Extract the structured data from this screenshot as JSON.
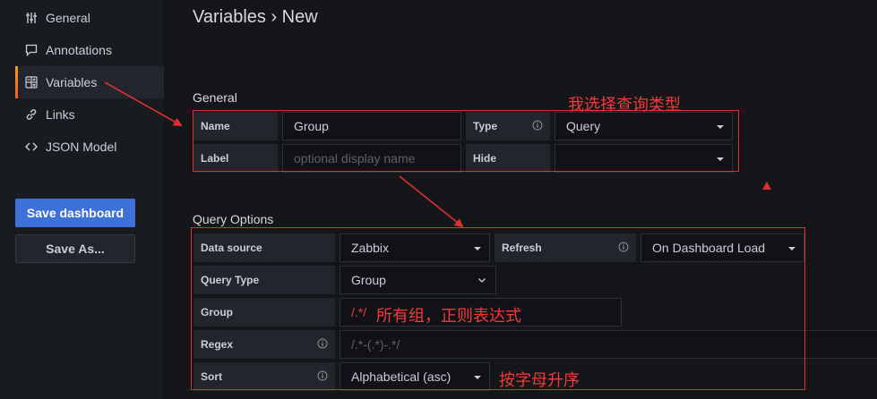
{
  "sidebar": {
    "items": [
      {
        "label": "General",
        "icon": "sliders-icon"
      },
      {
        "label": "Annotations",
        "icon": "comment-icon"
      },
      {
        "label": "Variables",
        "icon": "calculator-icon"
      },
      {
        "label": "Links",
        "icon": "link-icon"
      },
      {
        "label": "JSON Model",
        "icon": "code-icon"
      }
    ],
    "save_dashboard": "Save dashboard",
    "save_as": "Save As..."
  },
  "header": {
    "title": "Variables › New"
  },
  "general": {
    "heading": "General",
    "name_label": "Name",
    "name_value": "Group",
    "type_label": "Type",
    "type_value": "Query",
    "label_label": "Label",
    "label_placeholder": "optional display name",
    "hide_label": "Hide",
    "hide_value": ""
  },
  "query_options": {
    "heading": "Query Options",
    "datasource_label": "Data source",
    "datasource_value": "Zabbix",
    "refresh_label": "Refresh",
    "refresh_value": "On Dashboard Load",
    "query_type_label": "Query Type",
    "query_type_value": "Group",
    "group_label": "Group",
    "group_value": "/.*/",
    "regex_label": "Regex",
    "regex_placeholder": "/.*-(.*)-.*/",
    "sort_label": "Sort",
    "sort_value": "Alphabetical (asc)"
  },
  "annotations": {
    "select_type": "我选择查询类型",
    "all_groups": "所有组，正则表达式",
    "sort_alpha": "按字母升序"
  },
  "colors": {
    "accent_red": "#e02f2f",
    "primary_blue": "#3d71d9",
    "active_orange": "#f99b1f"
  }
}
